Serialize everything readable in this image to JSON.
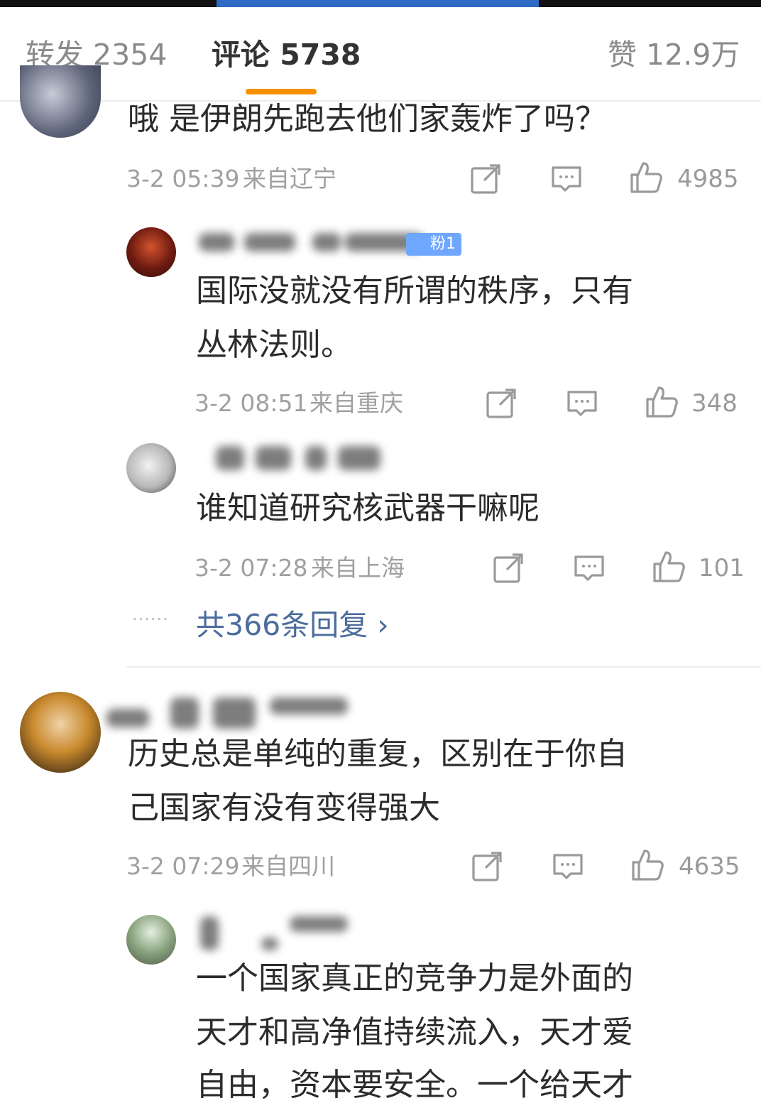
{
  "tabs": {
    "repost": "转发 2354",
    "comment": "评论 5738",
    "like": "赞 12.9万"
  },
  "comments": [
    {
      "text": "哦 是伊朗先跑去他们家轰炸了吗？",
      "time": "3-2 05:39",
      "location": "来自辽宁",
      "likes": "4985",
      "replies": [
        {
          "badge": "粉1",
          "text_lines": [
            "国际没就没有所谓的秩序，只有",
            "丛林法则。"
          ],
          "time": "3-2 08:51",
          "location": "来自重庆",
          "likes": "348"
        },
        {
          "text_lines": [
            "谁知道研究核武器干嘛呢"
          ],
          "time": "3-2 07:28",
          "location": "来自上海",
          "likes": "101"
        }
      ],
      "more_replies": "共366条回复 ›"
    },
    {
      "text_lines": [
        "历史总是单纯的重复，区别在于你自",
        "己国家有没有变得强大"
      ],
      "time": "3-2 07:29",
      "location": "来自四川",
      "likes": "4635",
      "replies": [
        {
          "text_lines": [
            "一个国家真正的竞争力是外面的",
            "天才和高净值持续流入，天才爱",
            "自由，资本要安全。一个给天才"
          ]
        }
      ]
    }
  ],
  "colors": {
    "accent_orange": "#f79100",
    "progress_blue": "#2d6ac4",
    "link_blue": "#4c6c9d",
    "fan_badge": "#6fa7ff"
  },
  "icons": [
    "repost-icon",
    "reply-icon",
    "thumbs-up-icon"
  ]
}
